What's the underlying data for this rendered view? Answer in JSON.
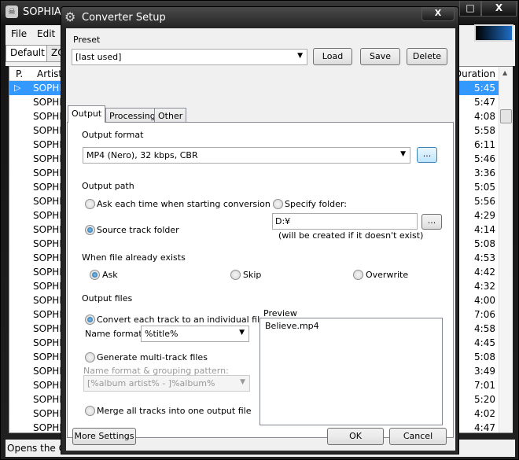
{
  "main_window": {
    "title": "SOPHIA",
    "menu": [
      "File",
      "Edit"
    ],
    "playlist_tabs": [
      "Default",
      "ZO"
    ],
    "columns": {
      "playing": "P.",
      "artist": "Artist",
      "duration": "Duration"
    },
    "rows": [
      {
        "artist": "SOPHIA",
        "duration": "5:45",
        "playing": true
      },
      {
        "artist": "SOPHIA",
        "duration": "5:47"
      },
      {
        "artist": "SOPHIA",
        "duration": "4:08"
      },
      {
        "artist": "SOPHIA",
        "duration": "5:58"
      },
      {
        "artist": "SOPHIA",
        "duration": "6:11"
      },
      {
        "artist": "SOPHIA",
        "duration": "5:46"
      },
      {
        "artist": "SOPHIA",
        "duration": "3:36"
      },
      {
        "artist": "SOPHIA",
        "duration": "5:05"
      },
      {
        "artist": "SOPHIA",
        "duration": "5:56"
      },
      {
        "artist": "SOPHIA",
        "duration": "4:29"
      },
      {
        "artist": "SOPHIA",
        "duration": "4:14"
      },
      {
        "artist": "SOPHIA",
        "duration": "5:08"
      },
      {
        "artist": "SOPHIA",
        "duration": "4:53"
      },
      {
        "artist": "SOPHIA",
        "duration": "4:42"
      },
      {
        "artist": "SOPHIA",
        "duration": "4:32"
      },
      {
        "artist": "SOPHIA",
        "duration": "4:00"
      },
      {
        "artist": "SOPHIA",
        "duration": "7:06"
      },
      {
        "artist": "SOPHIA",
        "duration": "4:58"
      },
      {
        "artist": "SOPHIA",
        "duration": "4:45"
      },
      {
        "artist": "SOPHIA",
        "duration": "5:08"
      },
      {
        "artist": "SOPHIA",
        "duration": "3:49"
      },
      {
        "artist": "SOPHIA",
        "duration": "7:01"
      },
      {
        "artist": "SOPHIA",
        "duration": "5:20"
      },
      {
        "artist": "SOPHIA",
        "duration": "4:02"
      },
      {
        "artist": "SOPHIA",
        "duration": "4:47"
      }
    ],
    "status": "Opens the C",
    "selection_color": "#3399ff",
    "window_buttons": {
      "maximize": "□",
      "close": "X"
    }
  },
  "dialog": {
    "title": "Converter Setup",
    "close": "X",
    "preset": {
      "label": "Preset",
      "value": "[last used]",
      "load": "Load",
      "save": "Save",
      "delete": "Delete"
    },
    "tabs": [
      "Output",
      "Processing",
      "Other"
    ],
    "active_tab": "Output",
    "output_format": {
      "label": "Output format",
      "value": "MP4 (Nero), 32 kbps, CBR",
      "browse": "..."
    },
    "output_path": {
      "label": "Output path",
      "ask": "Ask each time when starting conversion",
      "source": "Source track folder",
      "specify": "Specify folder:",
      "folder": "D:¥",
      "browse": "...",
      "hint": "(will be created if it doesn't exist)",
      "selected": "source"
    },
    "exists": {
      "label": "When file already exists",
      "ask": "Ask",
      "skip": "Skip",
      "overwrite": "Overwrite",
      "selected": "ask"
    },
    "output_files": {
      "label": "Output files",
      "individual": "Convert each track to an individual file",
      "name_format_label": "Name format:",
      "name_format": "%title%",
      "multi": "Generate multi-track files",
      "grouping_label": "Name format & grouping pattern:",
      "grouping": "[%album artist% - ]%album%",
      "merge": "Merge all tracks into one output file",
      "selected": "individual"
    },
    "preview": {
      "label": "Preview",
      "items": [
        "Believe.mp4"
      ]
    },
    "more_settings": "More Settings",
    "ok": "OK",
    "cancel": "Cancel"
  }
}
